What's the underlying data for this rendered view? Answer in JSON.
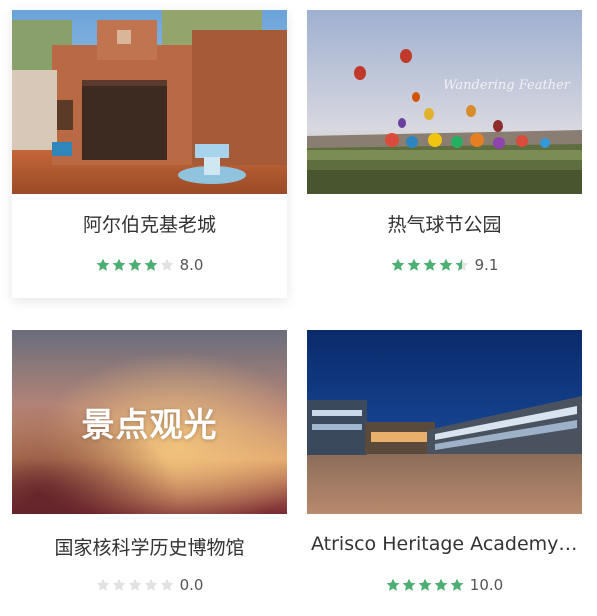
{
  "cards": [
    {
      "title": "阿尔伯克基老城",
      "score": "8.0",
      "rating": 4,
      "image": "old-town-adobe-photo"
    },
    {
      "title": "热气球节公园",
      "score": "9.1",
      "rating": 4.5,
      "image": "balloon-fiesta-photo",
      "watermark": "Wandering Feather"
    },
    {
      "title": "国家核科学历史博物馆",
      "score": "0.0",
      "rating": 0,
      "image": "blurred-placeholder",
      "overlay_text": "景点观光"
    },
    {
      "title": "Atrisco Heritage Academy H...",
      "score": "10.0",
      "rating": 5,
      "image": "school-building-night-photo"
    }
  ],
  "colors": {
    "star_filled": "#4caf73",
    "star_empty": "#e2e2e2"
  }
}
